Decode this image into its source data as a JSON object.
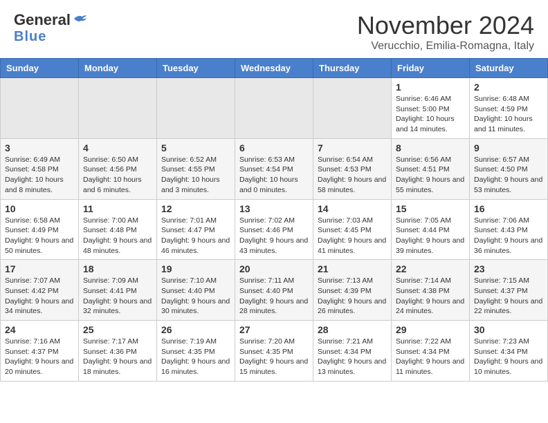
{
  "header": {
    "logo_general": "General",
    "logo_blue": "Blue",
    "month_title": "November 2024",
    "location": "Verucchio, Emilia-Romagna, Italy"
  },
  "days_of_week": [
    "Sunday",
    "Monday",
    "Tuesday",
    "Wednesday",
    "Thursday",
    "Friday",
    "Saturday"
  ],
  "weeks": [
    [
      {
        "day": "",
        "info": "",
        "empty": true
      },
      {
        "day": "",
        "info": "",
        "empty": true
      },
      {
        "day": "",
        "info": "",
        "empty": true
      },
      {
        "day": "",
        "info": "",
        "empty": true
      },
      {
        "day": "",
        "info": "",
        "empty": true
      },
      {
        "day": "1",
        "info": "Sunrise: 6:46 AM\nSunset: 5:00 PM\nDaylight: 10 hours and 14 minutes."
      },
      {
        "day": "2",
        "info": "Sunrise: 6:48 AM\nSunset: 4:59 PM\nDaylight: 10 hours and 11 minutes."
      }
    ],
    [
      {
        "day": "3",
        "info": "Sunrise: 6:49 AM\nSunset: 4:58 PM\nDaylight: 10 hours and 8 minutes."
      },
      {
        "day": "4",
        "info": "Sunrise: 6:50 AM\nSunset: 4:56 PM\nDaylight: 10 hours and 6 minutes."
      },
      {
        "day": "5",
        "info": "Sunrise: 6:52 AM\nSunset: 4:55 PM\nDaylight: 10 hours and 3 minutes."
      },
      {
        "day": "6",
        "info": "Sunrise: 6:53 AM\nSunset: 4:54 PM\nDaylight: 10 hours and 0 minutes."
      },
      {
        "day": "7",
        "info": "Sunrise: 6:54 AM\nSunset: 4:53 PM\nDaylight: 9 hours and 58 minutes."
      },
      {
        "day": "8",
        "info": "Sunrise: 6:56 AM\nSunset: 4:51 PM\nDaylight: 9 hours and 55 minutes."
      },
      {
        "day": "9",
        "info": "Sunrise: 6:57 AM\nSunset: 4:50 PM\nDaylight: 9 hours and 53 minutes."
      }
    ],
    [
      {
        "day": "10",
        "info": "Sunrise: 6:58 AM\nSunset: 4:49 PM\nDaylight: 9 hours and 50 minutes."
      },
      {
        "day": "11",
        "info": "Sunrise: 7:00 AM\nSunset: 4:48 PM\nDaylight: 9 hours and 48 minutes."
      },
      {
        "day": "12",
        "info": "Sunrise: 7:01 AM\nSunset: 4:47 PM\nDaylight: 9 hours and 46 minutes."
      },
      {
        "day": "13",
        "info": "Sunrise: 7:02 AM\nSunset: 4:46 PM\nDaylight: 9 hours and 43 minutes."
      },
      {
        "day": "14",
        "info": "Sunrise: 7:03 AM\nSunset: 4:45 PM\nDaylight: 9 hours and 41 minutes."
      },
      {
        "day": "15",
        "info": "Sunrise: 7:05 AM\nSunset: 4:44 PM\nDaylight: 9 hours and 39 minutes."
      },
      {
        "day": "16",
        "info": "Sunrise: 7:06 AM\nSunset: 4:43 PM\nDaylight: 9 hours and 36 minutes."
      }
    ],
    [
      {
        "day": "17",
        "info": "Sunrise: 7:07 AM\nSunset: 4:42 PM\nDaylight: 9 hours and 34 minutes."
      },
      {
        "day": "18",
        "info": "Sunrise: 7:09 AM\nSunset: 4:41 PM\nDaylight: 9 hours and 32 minutes."
      },
      {
        "day": "19",
        "info": "Sunrise: 7:10 AM\nSunset: 4:40 PM\nDaylight: 9 hours and 30 minutes."
      },
      {
        "day": "20",
        "info": "Sunrise: 7:11 AM\nSunset: 4:40 PM\nDaylight: 9 hours and 28 minutes."
      },
      {
        "day": "21",
        "info": "Sunrise: 7:13 AM\nSunset: 4:39 PM\nDaylight: 9 hours and 26 minutes."
      },
      {
        "day": "22",
        "info": "Sunrise: 7:14 AM\nSunset: 4:38 PM\nDaylight: 9 hours and 24 minutes."
      },
      {
        "day": "23",
        "info": "Sunrise: 7:15 AM\nSunset: 4:37 PM\nDaylight: 9 hours and 22 minutes."
      }
    ],
    [
      {
        "day": "24",
        "info": "Sunrise: 7:16 AM\nSunset: 4:37 PM\nDaylight: 9 hours and 20 minutes."
      },
      {
        "day": "25",
        "info": "Sunrise: 7:17 AM\nSunset: 4:36 PM\nDaylight: 9 hours and 18 minutes."
      },
      {
        "day": "26",
        "info": "Sunrise: 7:19 AM\nSunset: 4:35 PM\nDaylight: 9 hours and 16 minutes."
      },
      {
        "day": "27",
        "info": "Sunrise: 7:20 AM\nSunset: 4:35 PM\nDaylight: 9 hours and 15 minutes."
      },
      {
        "day": "28",
        "info": "Sunrise: 7:21 AM\nSunset: 4:34 PM\nDaylight: 9 hours and 13 minutes."
      },
      {
        "day": "29",
        "info": "Sunrise: 7:22 AM\nSunset: 4:34 PM\nDaylight: 9 hours and 11 minutes."
      },
      {
        "day": "30",
        "info": "Sunrise: 7:23 AM\nSunset: 4:34 PM\nDaylight: 9 hours and 10 minutes."
      }
    ]
  ]
}
